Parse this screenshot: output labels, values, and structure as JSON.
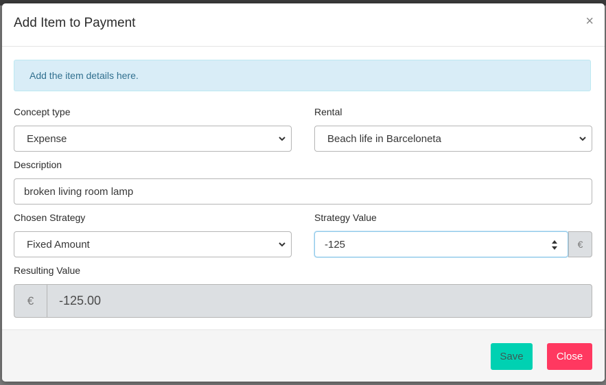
{
  "modal": {
    "title": "Add Item to Payment",
    "close_glyph": "×"
  },
  "notice": {
    "text": "Add the item details here."
  },
  "form": {
    "concept_type": {
      "label": "Concept type",
      "value": "Expense"
    },
    "rental": {
      "label": "Rental",
      "value": "Beach life in Barceloneta"
    },
    "description": {
      "label": "Description",
      "value": "broken living room lamp"
    },
    "chosen_strategy": {
      "label": "Chosen Strategy",
      "value": "Fixed Amount"
    },
    "strategy_value": {
      "label": "Strategy Value",
      "value": "-125",
      "currency": "€"
    },
    "resulting_value": {
      "label": "Resulting Value",
      "currency": "€",
      "value": "-125.00"
    }
  },
  "footer": {
    "save_label": "Save",
    "close_label": "Close"
  },
  "colors": {
    "save": "#00d1b2",
    "close": "#ff3860",
    "notice_bg": "#d9edf7"
  },
  "icons": {
    "select": "chevron-down-icon",
    "spinner": "spinner-arrows-icon",
    "close": "close-icon"
  }
}
